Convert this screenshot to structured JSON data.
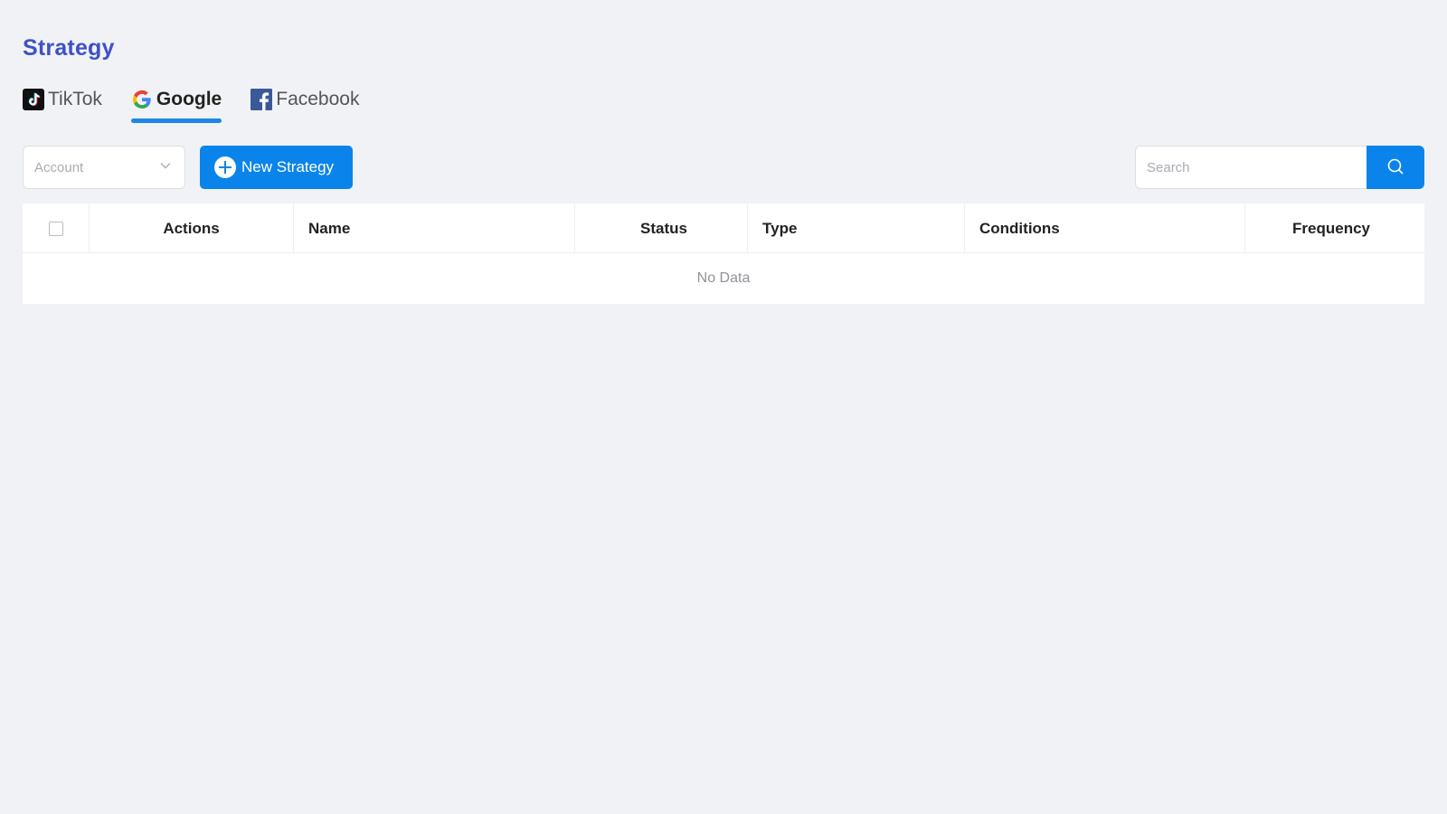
{
  "page": {
    "title": "Strategy"
  },
  "tabs": [
    {
      "label": "TikTok",
      "icon": "tiktok-icon",
      "active": false
    },
    {
      "label": "Google",
      "icon": "google-icon",
      "active": true
    },
    {
      "label": "Facebook",
      "icon": "facebook-icon",
      "active": false
    }
  ],
  "toolbar": {
    "account_placeholder": "Account",
    "new_strategy_label": "New Strategy",
    "search_placeholder": "Search"
  },
  "table": {
    "columns": [
      "Actions",
      "Name",
      "Status",
      "Type",
      "Conditions",
      "Frequency"
    ],
    "empty_text": "No Data"
  },
  "colors": {
    "title": "#3f51c5",
    "primary": "#0a84ea",
    "tab_underline": "#1b87e8",
    "background": "#f0f2f6"
  }
}
